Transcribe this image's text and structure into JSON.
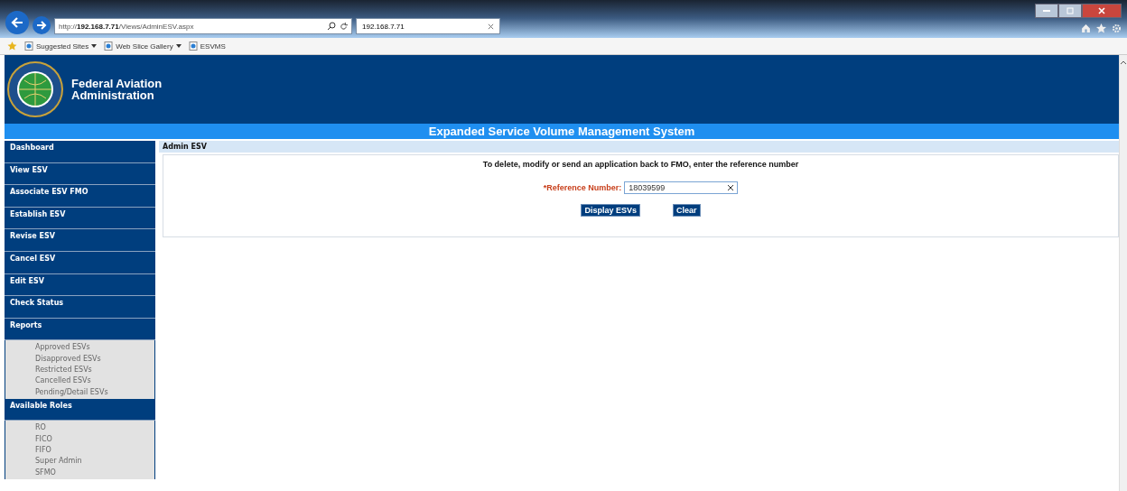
{
  "browser": {
    "address_parts": [
      {
        "text": "http://",
        "bold": false
      },
      {
        "text": "192.168.7.71",
        "bold": true
      },
      {
        "text": "/Views/AdminESV.aspx",
        "bold": false
      }
    ],
    "tab_title": "192.168.7.71",
    "favorites": [
      {
        "label": "Suggested Sites",
        "dropdown": true
      },
      {
        "label": "Web Slice Gallery",
        "dropdown": true
      },
      {
        "label": "ESVMS",
        "dropdown": false
      }
    ]
  },
  "header": {
    "org_line1": "Federal Aviation",
    "org_line2": "Administration",
    "system_title": "Expanded Service Volume Management System"
  },
  "sidebar": [
    {
      "kind": "menu",
      "label": "Dashboard"
    },
    {
      "kind": "menu",
      "label": "View ESV"
    },
    {
      "kind": "menu",
      "label": "Associate ESV FMO"
    },
    {
      "kind": "menu",
      "label": "Establish ESV"
    },
    {
      "kind": "menu",
      "label": "Revise ESV"
    },
    {
      "kind": "menu",
      "label": "Cancel ESV"
    },
    {
      "kind": "menu",
      "label": "Edit ESV"
    },
    {
      "kind": "menu",
      "label": "Check Status"
    },
    {
      "kind": "menu",
      "label": "Reports",
      "children": [
        "Approved ESVs",
        "Disapproved ESVs",
        "Restricted ESVs",
        "Cancelled ESVs",
        "Pending/Detail ESVs"
      ]
    },
    {
      "kind": "menu",
      "label": "Available Roles",
      "children": [
        "RO",
        "FICO",
        "FIFO",
        "Super Admin",
        "SFMO"
      ]
    }
  ],
  "main": {
    "section_title": "Admin ESV",
    "instruction": "To delete, modify or send an application back to FMO, enter the reference number",
    "field_label": "*Reference Number:",
    "field_value": "18039599",
    "buttons": [
      "Display ESVs",
      "Clear"
    ]
  }
}
